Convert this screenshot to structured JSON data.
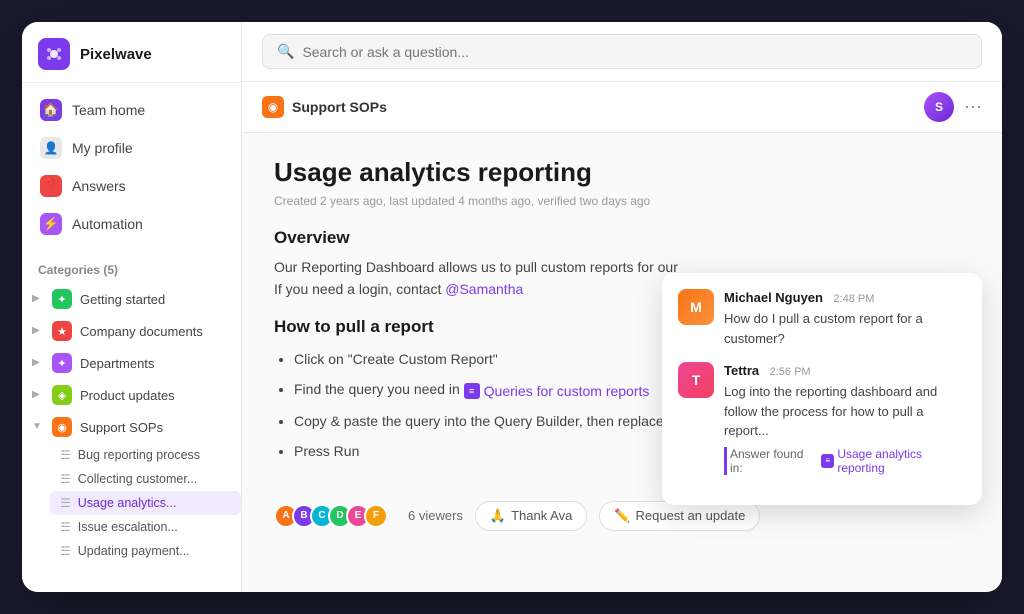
{
  "app": {
    "name": "Pixelwave"
  },
  "sidebar": {
    "nav": [
      {
        "id": "team-home",
        "label": "Team home",
        "icon": "🏠",
        "iconClass": "nav-icon-home"
      },
      {
        "id": "my-profile",
        "label": "My profile",
        "icon": "👤",
        "iconClass": "nav-icon-profile"
      },
      {
        "id": "answers",
        "label": "Answers",
        "icon": "❓",
        "iconClass": "nav-icon-answers"
      },
      {
        "id": "automation",
        "label": "Automation",
        "icon": "⚡",
        "iconClass": "nav-icon-automation"
      }
    ],
    "categories_header": "Categories (5)",
    "categories": [
      {
        "id": "getting-started",
        "label": "Getting started",
        "iconClass": "cat-icon-green",
        "icon": "✦",
        "expanded": false
      },
      {
        "id": "company-docs",
        "label": "Company documents",
        "iconClass": "cat-icon-red",
        "icon": "★",
        "expanded": false
      },
      {
        "id": "departments",
        "label": "Departments",
        "iconClass": "cat-icon-purple",
        "icon": "✦",
        "expanded": false
      },
      {
        "id": "product-updates",
        "label": "Product updates",
        "iconClass": "cat-icon-lime",
        "icon": "◈",
        "expanded": false
      },
      {
        "id": "support-sops",
        "label": "Support SOPs",
        "iconClass": "cat-icon-orange",
        "icon": "◉",
        "expanded": true
      }
    ],
    "subcategories": [
      {
        "id": "bug-reporting",
        "label": "Bug reporting process",
        "active": false
      },
      {
        "id": "collecting-customer",
        "label": "Collecting customer...",
        "active": false
      },
      {
        "id": "usage-analytics",
        "label": "Usage analytics...",
        "active": true
      },
      {
        "id": "issue-escalation",
        "label": "Issue escalation...",
        "active": false
      },
      {
        "id": "updating-payment",
        "label": "Updating payment...",
        "active": false
      }
    ]
  },
  "header": {
    "search_placeholder": "Search or ask a question..."
  },
  "breadcrumb": {
    "label": "Support SOPs"
  },
  "article": {
    "title": "Usage analytics reporting",
    "meta": "Created 2 years ago, last updated 4 months ago, verified two days ago",
    "overview_heading": "Overview",
    "overview_text": "Our Reporting Dashboard allows us to pull custom reports for our",
    "overview_text2": "If you need a login, contact ",
    "mention": "@Samantha",
    "how_to_heading": "How to pull a report",
    "steps": [
      "Click on \"Create Custom Report\"",
      "Find the query you need in",
      "Copy & paste the query into the Query Builder, then replace the customer's team_id",
      "Press Run"
    ],
    "doc_link_label": "Queries for custom reports",
    "viewers_count": "6 viewers",
    "thank_btn": "Thank Ava",
    "update_btn": "Request an update"
  },
  "chat_popup": {
    "message1": {
      "name": "Michael Nguyen",
      "time": "2:48 PM",
      "text": "How do I pull a custom report for a customer?",
      "avatar_letter": "M"
    },
    "message2": {
      "name": "Tettra",
      "time": "2:56 PM",
      "text": "Log into the reporting dashboard and follow the process for how to pull a report...",
      "avatar_letter": "T"
    },
    "answer_found_label": "Answer found in:",
    "answer_link": "Usage analytics reporting"
  }
}
